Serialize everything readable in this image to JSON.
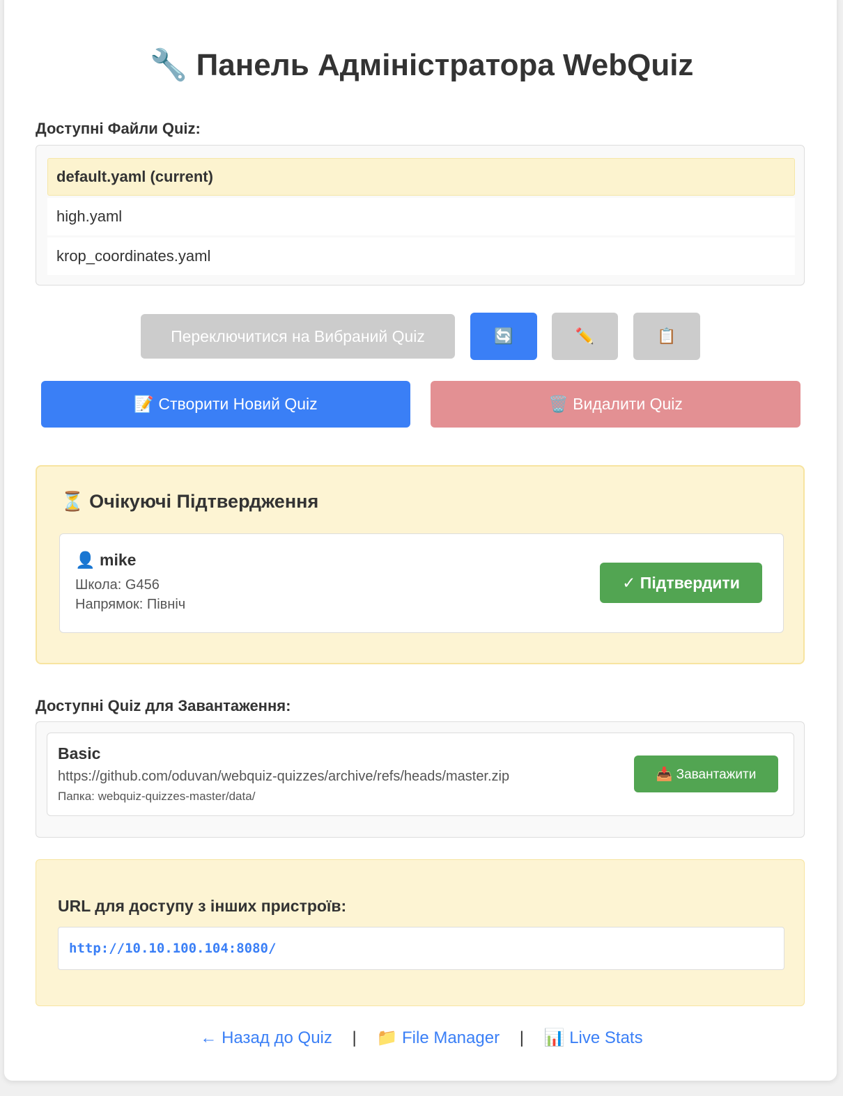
{
  "page": {
    "title_icon": "🔧",
    "title": "Панель Адміністратора WebQuiz"
  },
  "files": {
    "label": "Доступні Файли Quiz:",
    "items": [
      {
        "label": "default.yaml (current)",
        "current": true
      },
      {
        "label": "high.yaml",
        "current": false
      },
      {
        "label": "krop_coordinates.yaml",
        "current": false
      }
    ]
  },
  "toolbar": {
    "switch_label": "Переключитися на Вибраний Quiz",
    "refresh_icon": "🔄",
    "edit_icon": "✏️",
    "copy_icon": "📋",
    "create_label": "📝 Створити Новий Quiz",
    "delete_label": "🗑️ Видалити Quiz"
  },
  "pending": {
    "title": "⏳ Очікуючі Підтвердження",
    "user": {
      "name": "👤 mike",
      "school": "Школа: G456",
      "direction": "Напрямок: Північ"
    },
    "approve_label": "✓ Підтвердити"
  },
  "downloads": {
    "label": "Доступні Quiz для Завантаження:",
    "items": [
      {
        "name": "Basic",
        "url": "https://github.com/oduvan/webquiz-quizzes/archive/refs/heads/master.zip",
        "folder": "Папка: webquiz-quizzes-master/data/",
        "button": "📥 Завантажити"
      }
    ]
  },
  "network": {
    "label": "URL для доступу з інших пристроїв:",
    "url": "http://10.10.100.104:8080/"
  },
  "footer": {
    "back_link": "← Назад до Quiz",
    "separator": "|",
    "file_manager_link": "📁 File Manager",
    "live_stats_link": "📊 Live Stats"
  },
  "colors": {
    "accent": "#3a7ff6",
    "success": "#52a552",
    "danger_muted": "#e39093",
    "highlight": "#fcf3cf"
  }
}
